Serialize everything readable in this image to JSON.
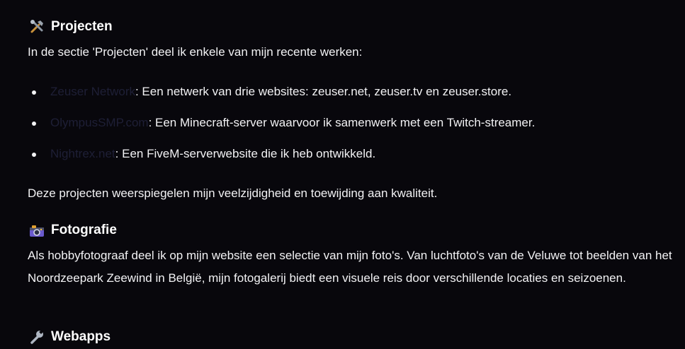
{
  "projects": {
    "title": "Projecten",
    "intro": "In de sectie 'Projecten' deel ik enkele van mijn recente werken:",
    "items": [
      {
        "link": "Zeuser Network",
        "text": ": Een netwerk van drie websites: zeuser.net, zeuser.tv en zeuser.store."
      },
      {
        "link": "OlympusSMP.com",
        "text": ": Een Minecraft-server waarvoor ik samenwerk met een Twitch-streamer."
      },
      {
        "link": "Nightrex.net",
        "text": ": Een FiveM-serverwebsite die ik heb ontwikkeld."
      }
    ],
    "outro": "Deze projecten weerspiegelen mijn veelzijdigheid en toewijding aan kwaliteit."
  },
  "photography": {
    "title": "Fotografie",
    "body": "Als hobbyfotograaf deel ik op mijn website een selectie van mijn foto's. Van luchtfoto's van de Veluwe tot beelden van het Noordzeepark Zeewind in België, mijn fotogalerij biedt een visuele reis door verschillende locaties en seizoenen."
  },
  "webapps": {
    "title": "Webapps"
  },
  "colors": {
    "background": "#08070c",
    "text": "#f2f2f4",
    "link": "#1e1f36"
  }
}
